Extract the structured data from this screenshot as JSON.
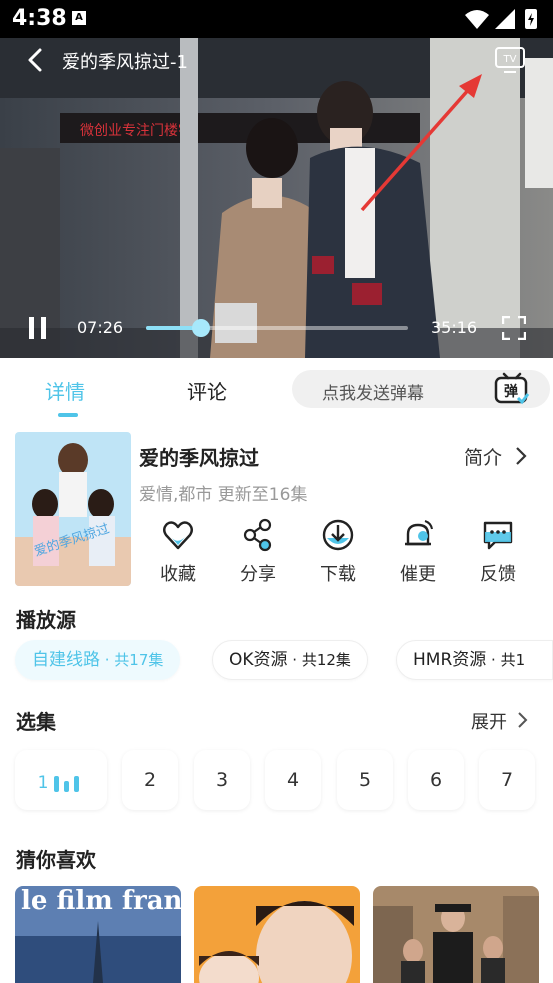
{
  "status_bar": {
    "time": "4:38",
    "app_badge": "A"
  },
  "player": {
    "title": "爱的季风掠过-1",
    "current_time": "07:26",
    "duration": "35:16",
    "progress_fraction": 0.21,
    "accent": "#8ee0f7"
  },
  "tabs": [
    {
      "label": "详情",
      "active": true
    },
    {
      "label": "评论",
      "active": false
    }
  ],
  "danmu": {
    "placeholder": "点我发送弹幕",
    "icon_label": "弹"
  },
  "show": {
    "title": "爱的季风掠过",
    "intro_label": "简介",
    "meta": "爱情,都市 更新至16集",
    "poster_text": "爱的季风掠过"
  },
  "actions": [
    {
      "label": "收藏",
      "icon": "heart-icon"
    },
    {
      "label": "分享",
      "icon": "share-icon"
    },
    {
      "label": "下载",
      "icon": "download-icon"
    },
    {
      "label": "催更",
      "icon": "bell-icon"
    },
    {
      "label": "反馈",
      "icon": "feedback-icon"
    }
  ],
  "sources": {
    "title": "播放源",
    "items": [
      {
        "name": "自建线路",
        "count": " · 共17集",
        "active": true
      },
      {
        "name": "OK资源",
        "count": " · 共12集",
        "active": false
      },
      {
        "name": "HMR资源",
        "count": " · 共1",
        "active": false
      }
    ]
  },
  "episodes": {
    "title": "选集",
    "expand_label": "展开",
    "items": [
      "1",
      "2",
      "3",
      "4",
      "5",
      "6",
      "7"
    ]
  },
  "recommend": {
    "title": "猜你喜欢",
    "items": [
      {
        "text": "le film français"
      },
      {
        "text": ""
      },
      {
        "text": ""
      }
    ]
  },
  "colors": {
    "accent": "#4fc4e8",
    "arrow": "#e53935"
  }
}
